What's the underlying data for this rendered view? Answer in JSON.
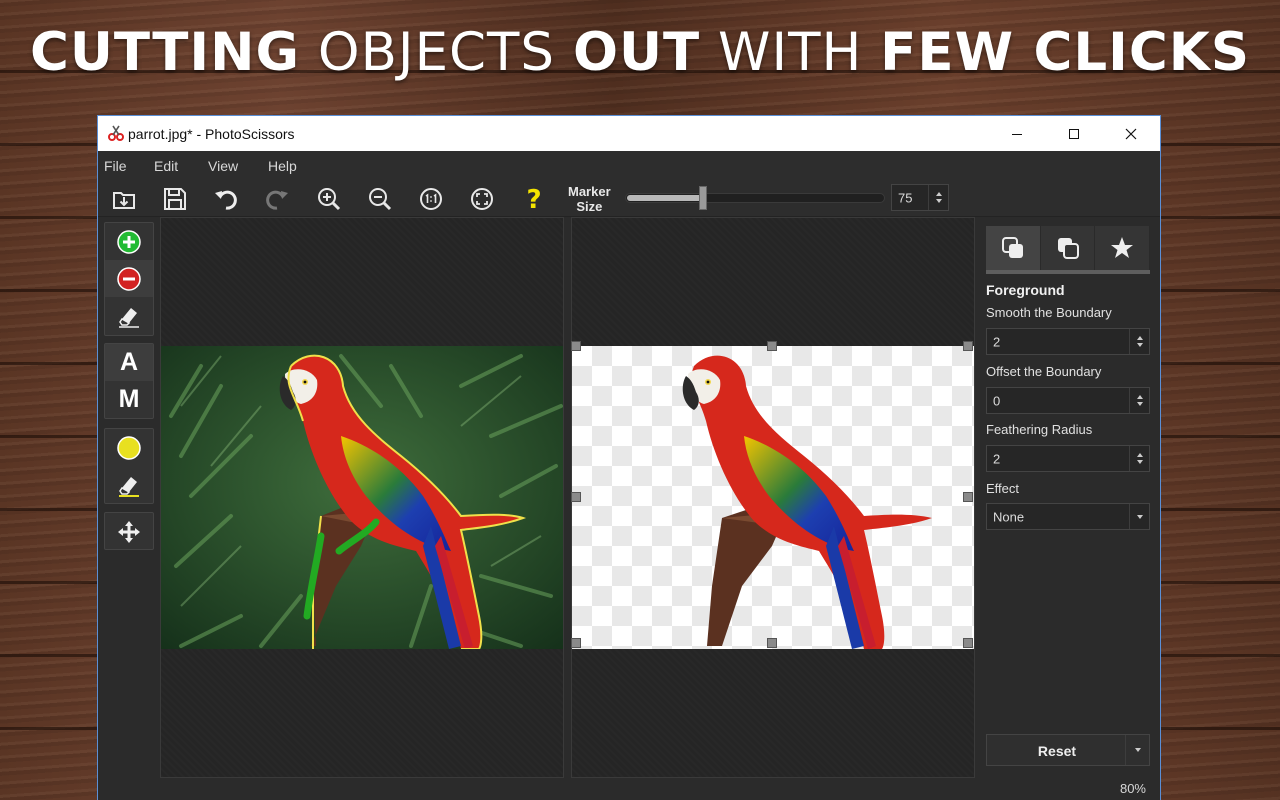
{
  "headline": {
    "w1": "CUTTING",
    "w2": "OBJECTS",
    "w3": "OUT",
    "w4": "WITH",
    "w5": "FEW CLICKS"
  },
  "window": {
    "title": "parrot.jpg* - PhotoScissors",
    "minimize_icon": "minimize-icon",
    "maximize_icon": "maximize-icon",
    "close_icon": "close-icon"
  },
  "menu": {
    "file": "File",
    "edit": "Edit",
    "view": "View",
    "help": "Help"
  },
  "toolbar": {
    "icons": [
      "open-icon",
      "save-icon",
      "undo-icon",
      "redo-icon",
      "zoom-in-icon",
      "zoom-out-icon",
      "actual-size-icon",
      "fit-window-icon",
      "help-icon"
    ],
    "marker_label_1": "Marker",
    "marker_label_2": "Size",
    "marker_value": "75",
    "marker_fraction": 0.3
  },
  "tools": {
    "auto_label": "A",
    "manual_label": "M"
  },
  "right_panel": {
    "section": "Foreground",
    "smooth_label": "Smooth the Boundary",
    "smooth_value": "2",
    "offset_label": "Offset the Boundary",
    "offset_value": "0",
    "feather_label": "Feathering Radius",
    "feather_value": "2",
    "effect_label": "Effect",
    "effect_value": "None",
    "reset_label": "Reset"
  },
  "status": {
    "zoom": "80%"
  },
  "colors": {
    "accent_green": "#22bb33",
    "accent_red": "#d22222",
    "marker_yellow": "#e8e020",
    "help_yellow": "#f4e400"
  }
}
